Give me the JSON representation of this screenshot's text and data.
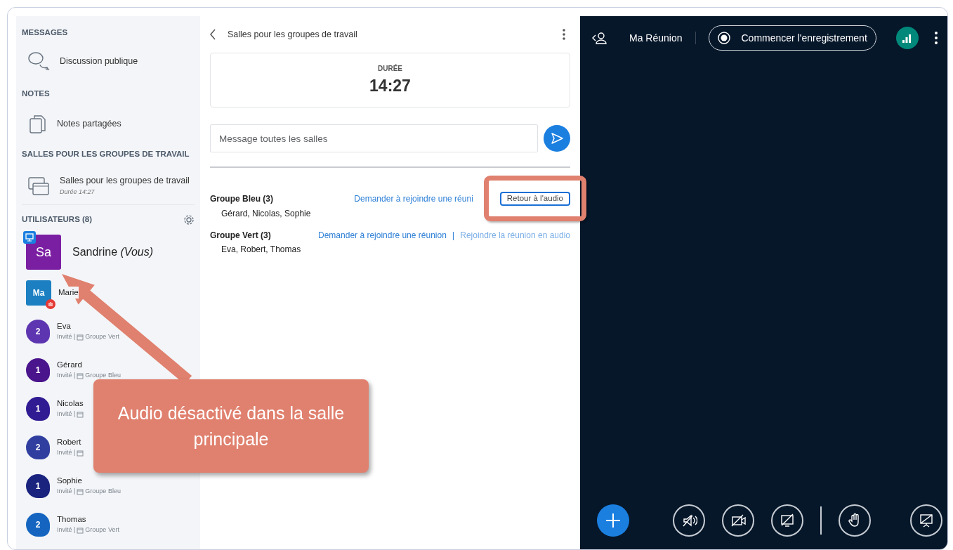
{
  "sidebar": {
    "sections": [
      {
        "heading": "MESSAGES",
        "items": [
          {
            "kind": "chat",
            "label": "Discussion publique"
          }
        ]
      },
      {
        "heading": "NOTES",
        "items": [
          {
            "kind": "notes",
            "label": "Notes partagées"
          }
        ]
      },
      {
        "heading": "SALLES POUR LES GROUPES DE TRAVAIL",
        "items": [
          {
            "kind": "rooms",
            "label": "Salles pour les groupes de travail",
            "sublabel": "Durée 14:27"
          }
        ]
      }
    ],
    "users_heading": "UTILISATEURS (8)",
    "users": [
      {
        "kind": "square",
        "initials": "Sa",
        "name": "Sandrine",
        "suffix": "(Vous)",
        "color": "#7b1fa2",
        "presenter": true,
        "raised_hand": false
      },
      {
        "kind": "square",
        "initials": "Ma",
        "name": "Marie",
        "color": "#1b7fc2",
        "presenter": false,
        "raised_hand": true
      },
      {
        "kind": "round",
        "initials": "2",
        "name": "Eva",
        "role": "Invité |",
        "room": "Groupe Vert",
        "color": "#5e35b1",
        "presenter": false,
        "raised_hand": false
      },
      {
        "kind": "round",
        "initials": "1",
        "name": "Gérard",
        "role": "Invité |",
        "room": "Groupe Bleu",
        "color": "#4a148c",
        "presenter": false,
        "raised_hand": false
      },
      {
        "kind": "round",
        "initials": "1",
        "name": "Nicolas",
        "role": "Invité |",
        "color": "#311b92",
        "presenter": false,
        "raised_hand": false
      },
      {
        "kind": "round",
        "initials": "2",
        "name": "Robert",
        "role": "Invité |",
        "color": "#303f9f",
        "presenter": false,
        "raised_hand": false
      },
      {
        "kind": "round",
        "initials": "1",
        "name": "Sophie",
        "role": "Invité |",
        "room": "Groupe Bleu",
        "color": "#1a237e",
        "presenter": false,
        "raised_hand": false
      },
      {
        "kind": "round",
        "initials": "2",
        "name": "Thomas",
        "role": "Invité |",
        "room": "Groupe Vert",
        "color": "#1565c0",
        "presenter": false,
        "raised_hand": false
      }
    ]
  },
  "panel": {
    "title": "Salles pour les groupes de travail",
    "duration_label": "DURÉE",
    "duration": "14:27",
    "message_placeholder": "Message toutes les salles",
    "groups": [
      {
        "name": "Groupe Bleu (3)",
        "members": "Gérard, Nicolas, Sophie",
        "actions": [
          {
            "kind": "link",
            "label": "Demander à rejoindre une réuni"
          },
          {
            "kind": "button",
            "label": "Retour à l'audio"
          }
        ]
      },
      {
        "name": "Groupe Vert (3)",
        "members": "Eva, Robert, Thomas",
        "actions": [
          {
            "kind": "link",
            "label": "Demander à rejoindre une réunion"
          },
          {
            "kind": "separator",
            "label": "|"
          },
          {
            "kind": "link-light",
            "label": "Rejoindre la réunion en audio"
          }
        ]
      }
    ]
  },
  "meeting": {
    "title": "Ma Réunion",
    "record_label": "Commencer l'enregistrement",
    "controls": [
      {
        "kind": "plus"
      },
      {
        "kind": "audio-off"
      },
      {
        "kind": "camera-off"
      },
      {
        "kind": "screen-off"
      },
      {
        "kind": "divider"
      },
      {
        "kind": "hand"
      },
      {
        "kind": "presentation"
      }
    ]
  },
  "annotation": {
    "text": "Audio désactivé dans la salle principale"
  }
}
